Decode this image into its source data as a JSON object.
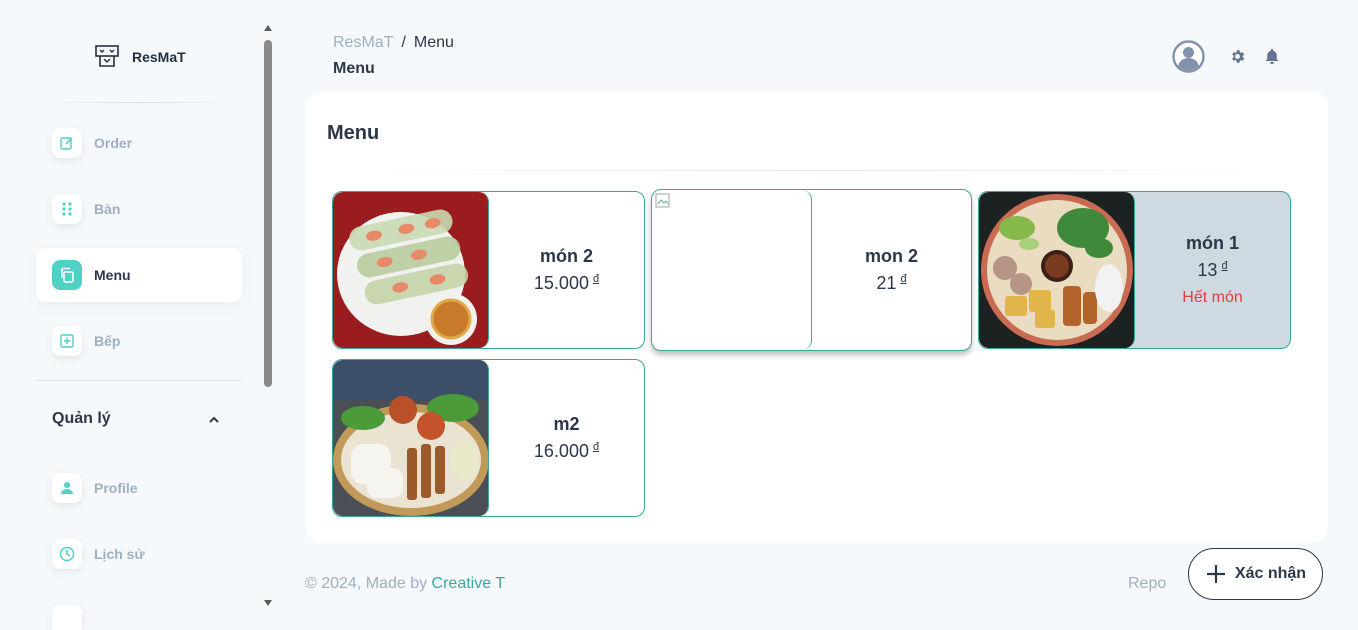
{
  "brand": {
    "name": "ResMaT"
  },
  "sidebar": {
    "items": [
      {
        "label": "Order",
        "icon": "edit-icon"
      },
      {
        "label": "Bàn",
        "icon": "grid-dots-icon"
      },
      {
        "label": "Menu",
        "icon": "copy-icon",
        "active": true
      },
      {
        "label": "Bếp",
        "icon": "plus-square-icon"
      }
    ],
    "section": {
      "title": "Quản lý"
    },
    "section_items": [
      {
        "label": "Profile",
        "icon": "person-icon"
      },
      {
        "label": "Lịch sử",
        "icon": "clock-icon"
      }
    ]
  },
  "header": {
    "breadcrumb_root": "ResMaT",
    "breadcrumb_sep": "/",
    "breadcrumb_current": "Menu",
    "page_title": "Menu"
  },
  "card": {
    "title": "Menu",
    "items": [
      {
        "name": "món 2",
        "price": "15.000",
        "currency": "đ",
        "image": "spring-rolls-photo"
      },
      {
        "name": "mon 2",
        "price": "21",
        "currency": "đ",
        "image": "broken-image"
      },
      {
        "name": "món 1",
        "price": "13",
        "currency": "đ",
        "status": "Hết món",
        "image": "noodle-platter-photo"
      },
      {
        "name": "m2",
        "price": "16.000",
        "currency": "đ",
        "image": "grilled-platter-photo"
      }
    ]
  },
  "footer": {
    "prefix": "© 2024, Made by ",
    "author": "Creative T",
    "repo": "Repo"
  },
  "confirm_button": {
    "label": "Xác nhận"
  },
  "colors": {
    "accent": "#4fd1c5",
    "accent_dark": "#38a89d",
    "danger": "#e53e3e",
    "soldout_bg": "#cfd9e2"
  }
}
